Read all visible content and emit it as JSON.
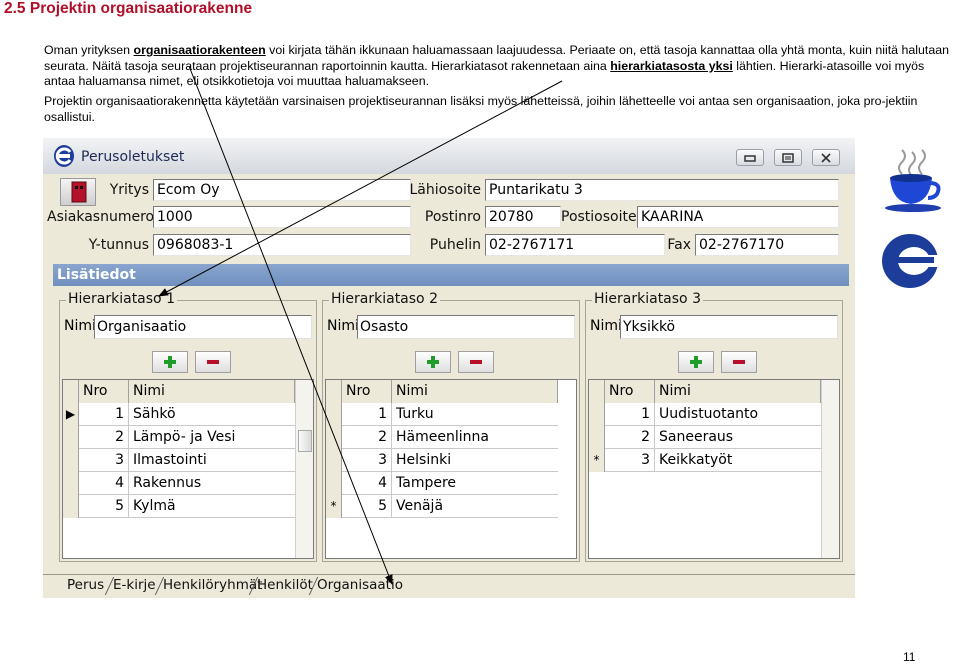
{
  "doc": {
    "heading": "2.5 Projektin organisaatiorakenne",
    "p1_a": "Oman yrityksen ",
    "p1_link": "organisaatiorakenteen",
    "p1_b": " voi kirjata tähän ikkunaan haluamassaan laajuudessa. Periaate on, että tasoja kannattaa olla yhtä monta, kuin niitä halutaan seurata. Näitä tasoja seurataan projektiseurannan raportoinnin kautta. Hierarkiatasot rakennetaan aina ",
    "p1_bold": "hierarkiatasosta yksi",
    "p1_c": " lähtien. Hierarki-atasoille voi myös antaa haluamansa nimet, eli otsikkotietoja voi muuttaa haluamakseen.",
    "p2": "Projektin organisaatiorakennetta käytetään varsinaisen projektiseurannan lisäksi myös lähetteissä, joihin lähetteelle voi antaa sen organisaation, joka pro-jektiin osallistui.",
    "page_number": "11"
  },
  "window": {
    "title": "Perusoletukset",
    "fields": {
      "yritys_label": "Yritys",
      "yritys": "Ecom Oy",
      "asiakasnumero_label": "Asiakasnumero",
      "asiakasnumero": "1000",
      "ytunnus_label": "Y-tunnus",
      "ytunnus": "0968083-1",
      "lahiosoite_label": "Lähiosoite",
      "lahiosoite": "Puntarikatu 3",
      "postinro_label": "Postinro",
      "postinro": "20780",
      "postiosoite_label": "Postiosoite",
      "postiosoite": "KAARINA",
      "puhelin_label": "Puhelin",
      "puhelin": "02-2767171",
      "fax_label": "Fax",
      "fax": "02-2767170"
    },
    "section_title": "Lisätiedot",
    "groups": [
      {
        "title": "Hierarkiataso 1",
        "nimi_label": "Nimi",
        "nimi": "Organisaatio",
        "col_nro": "Nro",
        "col_nimi": "Nimi",
        "rows": [
          {
            "marker": "▶",
            "nro": "1",
            "nimi": "Sähkö"
          },
          {
            "marker": "",
            "nro": "2",
            "nimi": "Lämpö- ja Vesi"
          },
          {
            "marker": "",
            "nro": "3",
            "nimi": "Ilmastointi"
          },
          {
            "marker": "",
            "nro": "4",
            "nimi": "Rakennus"
          },
          {
            "marker": "",
            "nro": "5",
            "nimi": "Kylmä"
          }
        ]
      },
      {
        "title": "Hierarkiataso 2",
        "nimi_label": "Nimi",
        "nimi": "Osasto",
        "col_nro": "Nro",
        "col_nimi": "Nimi",
        "rows": [
          {
            "marker": "",
            "nro": "1",
            "nimi": "Turku"
          },
          {
            "marker": "",
            "nro": "2",
            "nimi": "Hämeenlinna"
          },
          {
            "marker": "",
            "nro": "3",
            "nimi": "Helsinki"
          },
          {
            "marker": "",
            "nro": "4",
            "nimi": "Tampere"
          },
          {
            "marker": "*",
            "nro": "5",
            "nimi": "Venäjä"
          }
        ]
      },
      {
        "title": "Hierarkiataso 3",
        "nimi_label": "Nimi",
        "nimi": "Yksikkö",
        "col_nro": "Nro",
        "col_nimi": "Nimi",
        "rows": [
          {
            "marker": "",
            "nro": "1",
            "nimi": "Uudistuotanto"
          },
          {
            "marker": "",
            "nro": "2",
            "nimi": "Saneeraus"
          },
          {
            "marker": "*",
            "nro": "3",
            "nimi": "Keikkatyöt"
          }
        ]
      }
    ],
    "tabs": [
      "Perus",
      "E-kirje",
      "Henkilöryhmät",
      "Henkilöt",
      "Organisaatio"
    ],
    "colors": {
      "section_bar": "#7e9ac8",
      "add_green": "#1f9c2a",
      "remove_red": "#b8102a",
      "heading_red": "#b0102a"
    },
    "icons": [
      "app-logo-icon",
      "minimize-icon",
      "maximize-icon",
      "close-icon",
      "plus-icon",
      "minus-icon",
      "coffee-cup-icon",
      "c-logo-icon"
    ]
  }
}
